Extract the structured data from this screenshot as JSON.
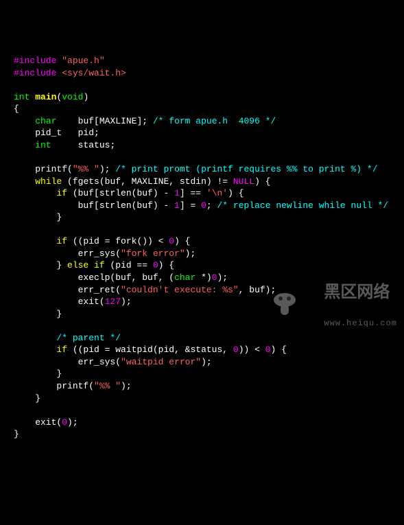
{
  "code": {
    "l01": {
      "a": "#include ",
      "b": "\"apue.h\""
    },
    "l02": {
      "a": "#include ",
      "b": "<sys/wait.h>"
    },
    "l04": {
      "a": "int",
      "b": " ",
      "c": "main",
      "d": "(",
      "e": "void",
      "f": ")"
    },
    "l05": {
      "a": "{"
    },
    "l06": {
      "a": "    ",
      "b": "char",
      "c": "    buf[MAXLINE]; ",
      "d": "/* form apue.h  4096 */"
    },
    "l07": {
      "a": "    pid_t   pid;"
    },
    "l08": {
      "a": "    ",
      "b": "int",
      "c": "     status;"
    },
    "l10": {
      "a": "    printf(",
      "b": "\"%% \"",
      "c": "); ",
      "d": "/* print promt (printf requires %% to print %) */"
    },
    "l11": {
      "a": "    ",
      "b": "while",
      "c": " (fgets(buf, MAXLINE, stdin) != ",
      "d": "NULL",
      "e": ") {"
    },
    "l12": {
      "a": "        ",
      "b": "if",
      "c": " (buf[strlen(buf) - ",
      "d": "1",
      "e": "] == ",
      "f": "'\\n'",
      "g": ") {"
    },
    "l13": {
      "a": "            buf[strlen(buf) - ",
      "b": "1",
      "c": "] = ",
      "d": "0",
      "e": "; ",
      "f": "/* replace newline while null */"
    },
    "l14": {
      "a": "        }"
    },
    "l16": {
      "a": "        ",
      "b": "if",
      "c": " ((pid = fork()) < ",
      "d": "0",
      "e": ") {"
    },
    "l17": {
      "a": "            err_sys(",
      "b": "\"fork error\"",
      "c": ");"
    },
    "l18": {
      "a": "        } ",
      "b": "else if",
      "c": " (pid == ",
      "d": "0",
      "e": ") {"
    },
    "l19": {
      "a": "            execlp(buf, buf, (",
      "b": "char",
      "c": " *)",
      "d": "0",
      "e": ");"
    },
    "l20": {
      "a": "            err_ret(",
      "b": "\"couldn't execute: %s\"",
      "c": ", buf);"
    },
    "l21": {
      "a": "            exit(",
      "b": "127",
      "c": ");"
    },
    "l22": {
      "a": "        }"
    },
    "l24": {
      "a": "        ",
      "b": "/* parent */"
    },
    "l25": {
      "a": "        ",
      "b": "if",
      "c": " ((pid = waitpid(pid, &status, ",
      "d": "0",
      "e": ")) < ",
      "f": "0",
      "g": ") {"
    },
    "l26": {
      "a": "            err_sys(",
      "b": "\"waitpid error\"",
      "c": ");"
    },
    "l27": {
      "a": "        }"
    },
    "l28": {
      "a": "        printf(",
      "b": "\"%% \"",
      "c": ");"
    },
    "l29": {
      "a": "    }"
    },
    "l31": {
      "a": "    exit(",
      "b": "0",
      "c": ");"
    },
    "l32": {
      "a": "}"
    }
  },
  "watermark": {
    "title": "黑区网络",
    "url": "www.heiqu.com"
  }
}
